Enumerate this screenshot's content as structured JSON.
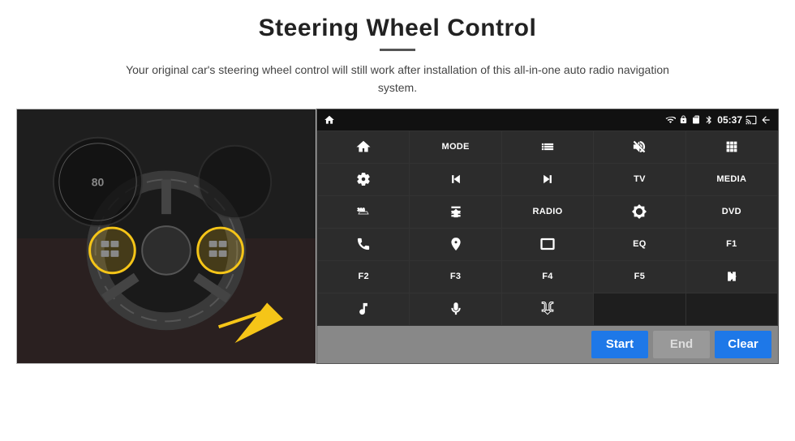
{
  "header": {
    "title": "Steering Wheel Control",
    "subtitle": "Your original car's steering wheel control will still work after installation of this all-in-one auto radio navigation system.",
    "divider": true
  },
  "status_bar": {
    "time": "05:37",
    "icons": [
      "wifi",
      "lock",
      "sd",
      "bluetooth",
      "cast",
      "back"
    ]
  },
  "buttons": [
    {
      "id": "r1c1",
      "type": "icon",
      "icon": "home",
      "label": ""
    },
    {
      "id": "r1c2",
      "type": "text",
      "label": "MODE"
    },
    {
      "id": "r1c3",
      "type": "icon",
      "icon": "list",
      "label": ""
    },
    {
      "id": "r1c4",
      "type": "icon",
      "icon": "mute",
      "label": ""
    },
    {
      "id": "r1c5",
      "type": "icon",
      "icon": "apps",
      "label": ""
    },
    {
      "id": "r2c1",
      "type": "icon",
      "icon": "settings-circle",
      "label": ""
    },
    {
      "id": "r2c2",
      "type": "icon",
      "icon": "prev",
      "label": ""
    },
    {
      "id": "r2c3",
      "type": "icon",
      "icon": "next",
      "label": ""
    },
    {
      "id": "r2c4",
      "type": "text",
      "label": "TV"
    },
    {
      "id": "r2c5",
      "type": "text",
      "label": "MEDIA"
    },
    {
      "id": "r3c1",
      "type": "icon",
      "icon": "360cam",
      "label": ""
    },
    {
      "id": "r3c2",
      "type": "icon",
      "icon": "eject",
      "label": ""
    },
    {
      "id": "r3c3",
      "type": "text",
      "label": "RADIO"
    },
    {
      "id": "r3c4",
      "type": "icon",
      "icon": "brightness",
      "label": ""
    },
    {
      "id": "r3c5",
      "type": "text",
      "label": "DVD"
    },
    {
      "id": "r4c1",
      "type": "icon",
      "icon": "phone",
      "label": ""
    },
    {
      "id": "r4c2",
      "type": "icon",
      "icon": "navi",
      "label": ""
    },
    {
      "id": "r4c3",
      "type": "icon",
      "icon": "screen",
      "label": ""
    },
    {
      "id": "r4c4",
      "type": "text",
      "label": "EQ"
    },
    {
      "id": "r4c5",
      "type": "text",
      "label": "F1"
    },
    {
      "id": "r5c1",
      "type": "text",
      "label": "F2"
    },
    {
      "id": "r5c2",
      "type": "text",
      "label": "F3"
    },
    {
      "id": "r5c3",
      "type": "text",
      "label": "F4"
    },
    {
      "id": "r5c4",
      "type": "text",
      "label": "F5"
    },
    {
      "id": "r5c5",
      "type": "icon",
      "icon": "play-pause",
      "label": ""
    },
    {
      "id": "r6c1",
      "type": "icon",
      "icon": "music-note",
      "label": ""
    },
    {
      "id": "r6c2",
      "type": "icon",
      "icon": "microphone",
      "label": ""
    },
    {
      "id": "r6c3",
      "type": "icon",
      "icon": "vol-call",
      "label": ""
    },
    {
      "id": "r6c4",
      "type": "empty",
      "label": ""
    },
    {
      "id": "r6c5",
      "type": "empty",
      "label": ""
    }
  ],
  "bottom_bar": {
    "start_label": "Start",
    "end_label": "End",
    "clear_label": "Clear"
  }
}
